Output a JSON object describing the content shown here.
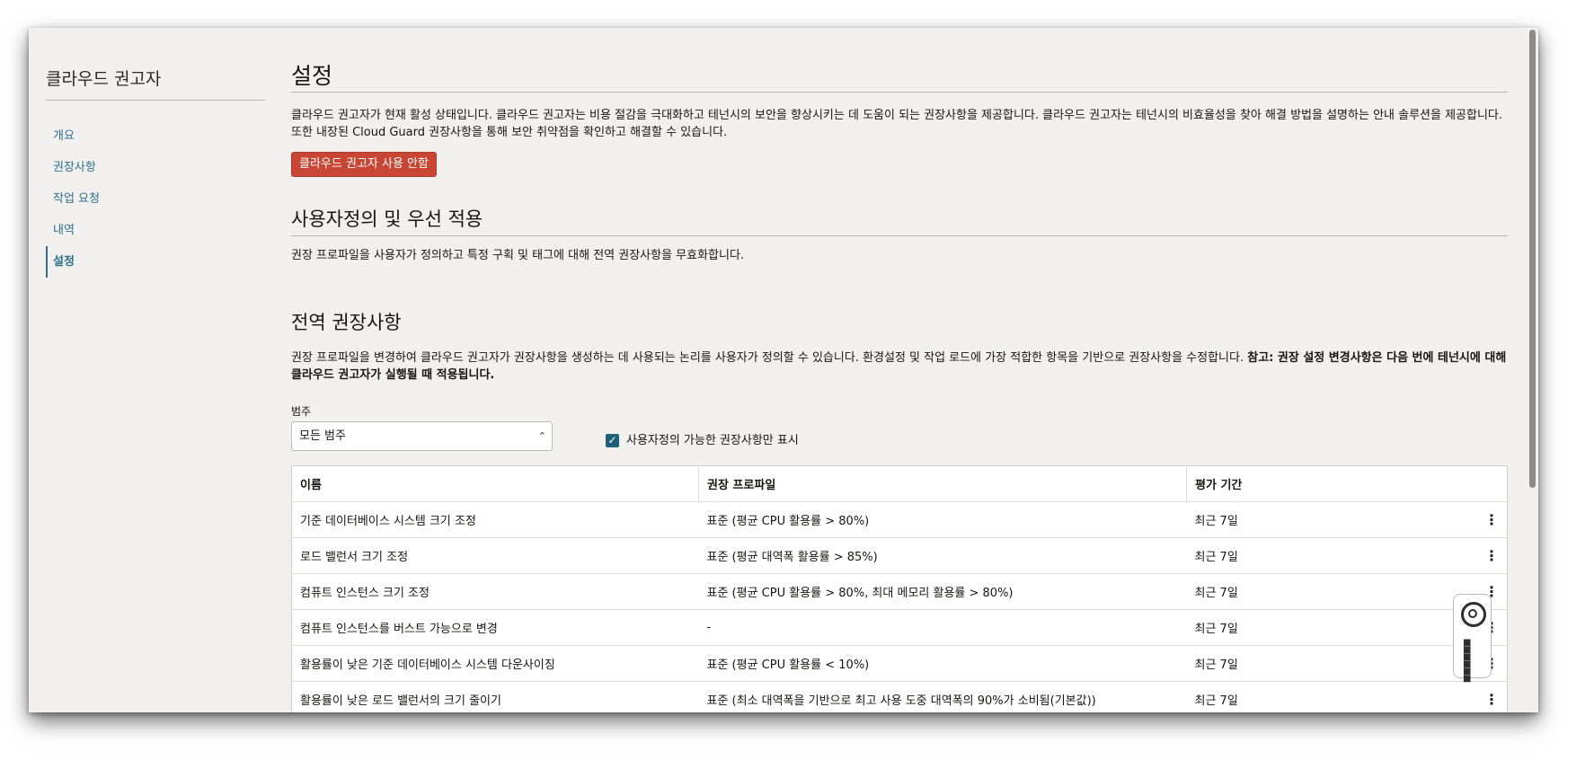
{
  "sidebar": {
    "title": "클라우드 권고자",
    "items": [
      "개요",
      "권장사항",
      "작업 요청",
      "내역",
      "설정"
    ]
  },
  "settings": {
    "title": "설정",
    "description": "클라우드 권고자가 현재 활성 상태입니다. 클라우드 권고자는 비용 절감을 극대화하고 테넌시의 보안을 향상시키는 데 도움이 되는 권장사항을 제공합니다. 클라우드 권고자는 테넌시의 비효율성을 찾아 해결 방법을 설명하는 안내 솔루션을 제공합니다. 또한 내장된 Cloud Guard 권장사항을 통해 보안 취약점을 확인하고 해결할 수 있습니다.",
    "opt_out_button": "클라우드 권고자 사용 안함"
  },
  "custom": {
    "title": "사용자정의 및 우선 적용",
    "description": "권장 프로파일을 사용자가 정의하고 특정 구획 및 태그에 대해 전역 권장사항을 무효화합니다."
  },
  "global": {
    "title": "전역 권장사항",
    "description": "권장 프로파일을 변경하여 클라우드 권고자가 권장사항을 생성하는 데 사용되는 논리를 사용자가 정의할 수 있습니다. 환경설정 및 작업 로드에 가장 적합한 항목을 기반으로 권장사항을 수정합니다. ",
    "note": "참고: 권장 설정 변경사항은 다음 번에 테넌시에 대해 클라우드 권고자가 실행될 때 적용됩니다.",
    "category_label": "범주",
    "category_value": "모든 범주",
    "checkbox_label": "사용자정의 가능한 권장사항만 표시",
    "checkbox_checked": true
  },
  "table": {
    "headers": [
      "이름",
      "권장 프로파일",
      "평가 기간"
    ],
    "rows": [
      {
        "name": "기준 데이터베이스 시스템 크기 조정",
        "profile": "표준 (평균 CPU 활용률 > 80%)",
        "period": "최근 7일"
      },
      {
        "name": "로드 밸런서 크기 조정",
        "profile": "표준 (평균 대역폭 활용률 > 85%)",
        "period": "최근 7일"
      },
      {
        "name": "컴퓨트 인스턴스 크기 조정",
        "profile": "표준 (평균 CPU 활용률 > 80%, 최대 메모리 활용률 > 80%)",
        "period": "최근 7일"
      },
      {
        "name": "컴퓨트 인스턴스를 버스트 가능으로 변경",
        "profile": "-",
        "period": "최근 7일"
      },
      {
        "name": "활용률이 낮은 기준 데이터베이스 시스템 다운사이징",
        "profile": "표준 (평균 CPU 활용률 < 10%)",
        "period": "최근 7일"
      },
      {
        "name": "활용률이 낮은 로드 밸런서의 크기 줄이기",
        "profile": "표준 (최소 대역폭을 기반으로 최고 사용 도중 대역폭의 90%가 소비됨(기본값))",
        "period": "최근 7일"
      }
    ]
  },
  "icons": {
    "kebab": "more-vertical-icon",
    "help": "lifebuoy-icon",
    "apps": "grid-dots-icon",
    "select_chevron": "chevron-updown-icon",
    "check": "checkmark-icon"
  },
  "colors": {
    "accent": "#2f6f8c",
    "danger_button": "#c74634",
    "background": "#f1f0ee"
  }
}
